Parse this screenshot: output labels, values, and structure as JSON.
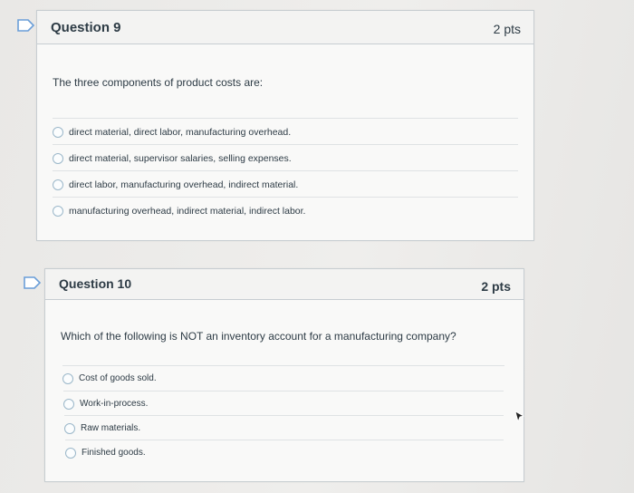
{
  "questions": [
    {
      "title": "Question 9",
      "points": "2 pts",
      "prompt": "The three components of product costs are:",
      "answers": [
        "direct material, direct labor, manufacturing overhead.",
        "direct material, supervisor salaries, selling expenses.",
        "direct labor, manufacturing overhead, indirect material.",
        "manufacturing overhead, indirect material, indirect labor."
      ]
    },
    {
      "title": "Question 10",
      "points": "2 pts",
      "prompt": "Which of the following is NOT an inventory account for a manufacturing company?",
      "answers": [
        "Cost of goods sold.",
        "Work-in-process.",
        "Raw materials.",
        "Finished goods."
      ]
    }
  ],
  "colors": {
    "accent": "#5b8fd0",
    "border": "#c7cdd1",
    "text": "#2d3b45"
  },
  "icons": {
    "flag": "bookmark-flag-icon",
    "radio": "radio-button-icon",
    "cursor": "mouse-pointer-icon"
  }
}
